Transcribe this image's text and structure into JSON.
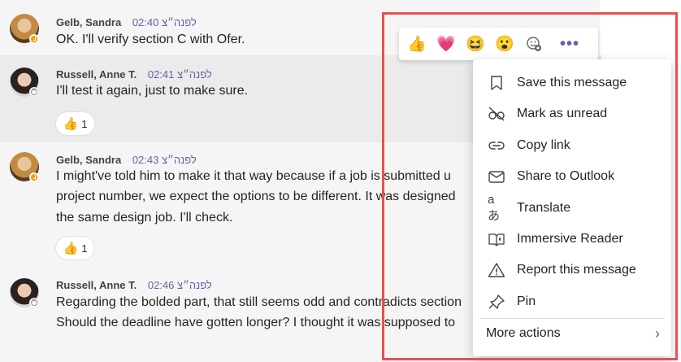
{
  "messages": [
    {
      "author": "Gelb, Sandra",
      "time": "לפנה״צ 02:40",
      "lines": [
        "OK. I'll verify section C with Ofer."
      ]
    },
    {
      "author": "Russell, Anne T.",
      "time": "לפנה״צ 02:41",
      "lines": [
        "I'll test it again, just to make sure."
      ],
      "reaction": {
        "emoji": "👍",
        "count": "1"
      }
    },
    {
      "author": "Gelb, Sandra",
      "time": "לפנה״צ 02:43",
      "lines": [
        "I might've told him to make it that way because if a job is submitted u",
        "project number, we expect the options to be different. It was designed",
        "the same design job. I'll check."
      ],
      "reaction": {
        "emoji": "👍",
        "count": "1"
      }
    },
    {
      "author": "Russell, Anne T.",
      "time": "לפנה״צ 02:46",
      "lines": [
        "Regarding the bolded part, that still seems odd and contradicts section",
        "Should the deadline have gotten longer? I thought it was supposed to"
      ]
    }
  ],
  "reaction_bar": {
    "reactions": [
      {
        "name": "like",
        "glyph": "👍"
      },
      {
        "name": "heart",
        "glyph": "💗"
      },
      {
        "name": "laugh",
        "glyph": "😆"
      },
      {
        "name": "surprised",
        "glyph": "😮"
      }
    ],
    "more_icon": "more-options-icon"
  },
  "menu": {
    "items": [
      {
        "label": "Save this message",
        "icon": "bookmark-icon"
      },
      {
        "label": "Mark as unread",
        "icon": "glasses-off-icon"
      },
      {
        "label": "Copy link",
        "icon": "link-icon"
      },
      {
        "label": "Share to Outlook",
        "icon": "mail-icon"
      },
      {
        "label": "Translate",
        "icon": "translate-icon"
      },
      {
        "label": "Immersive Reader",
        "icon": "immersive-reader-icon"
      },
      {
        "label": "Report this message",
        "icon": "warning-icon"
      },
      {
        "label": "Pin",
        "icon": "pin-icon"
      }
    ],
    "more_actions": "More actions"
  },
  "colors": {
    "accent": "#6264a7",
    "highlight_border": "#e8504f",
    "away": "#eaa300"
  }
}
